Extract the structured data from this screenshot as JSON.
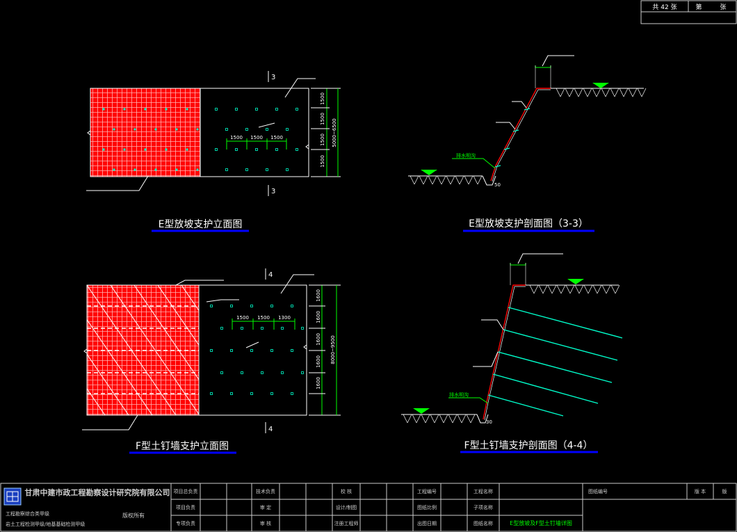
{
  "sheet": {
    "total_label": "共 42 张",
    "sheet_label": "第",
    "sheet_unit": "张"
  },
  "views": {
    "e_elev": {
      "title": "E型放坡支护立面图",
      "section_top": "3",
      "section_bottom": "3",
      "spacing_labels": [
        "1500",
        "1500",
        "1500"
      ],
      "height_labels": [
        "1500",
        "1500",
        "1500",
        "1500"
      ],
      "overall_height": "5000~6500"
    },
    "e_sect": {
      "title": "E型放坡支护剖面图（3-3）",
      "drain_label": "排水明沟",
      "ditch_dim": "50"
    },
    "f_elev": {
      "title": "F型土钉墙支护立面图",
      "section_top": "4",
      "section_bottom": "4",
      "spacing_labels": [
        "1500",
        "1500",
        "1300"
      ],
      "height_labels": [
        "1600",
        "1600",
        "1600",
        "1600",
        "1600"
      ],
      "overall_height": "8000~9500"
    },
    "f_sect": {
      "title": "F型土钉墙支护剖面图（4-4）",
      "drain_label": "排水明沟",
      "ditch_dim": "30"
    }
  },
  "titleblock": {
    "company": "甘肃中建市政工程勘察设计研究院有限公司",
    "dept1": "工程勘察综合类甲级",
    "dept2": "岩土工程检测甲级/地基基础检测甲级",
    "copyright": "版权所有",
    "roles_a": [
      "项目总负责",
      "项目负责",
      "专项负责"
    ],
    "roles_b": [
      "技术负责",
      "审 定",
      "审 核"
    ],
    "roles_c": [
      "校 核",
      "设计/制图",
      "注册工程师"
    ],
    "roles_d": [
      "工程编号",
      "图纸比例",
      "出图日期"
    ],
    "roles_e": [
      "工程名称",
      "子项名称",
      "图纸名称"
    ],
    "drawing_name": "E型放坡及F型土钉墙详图",
    "drawing_no_label": "图纸编号",
    "version_label": "版 本",
    "version_unit": "版"
  }
}
